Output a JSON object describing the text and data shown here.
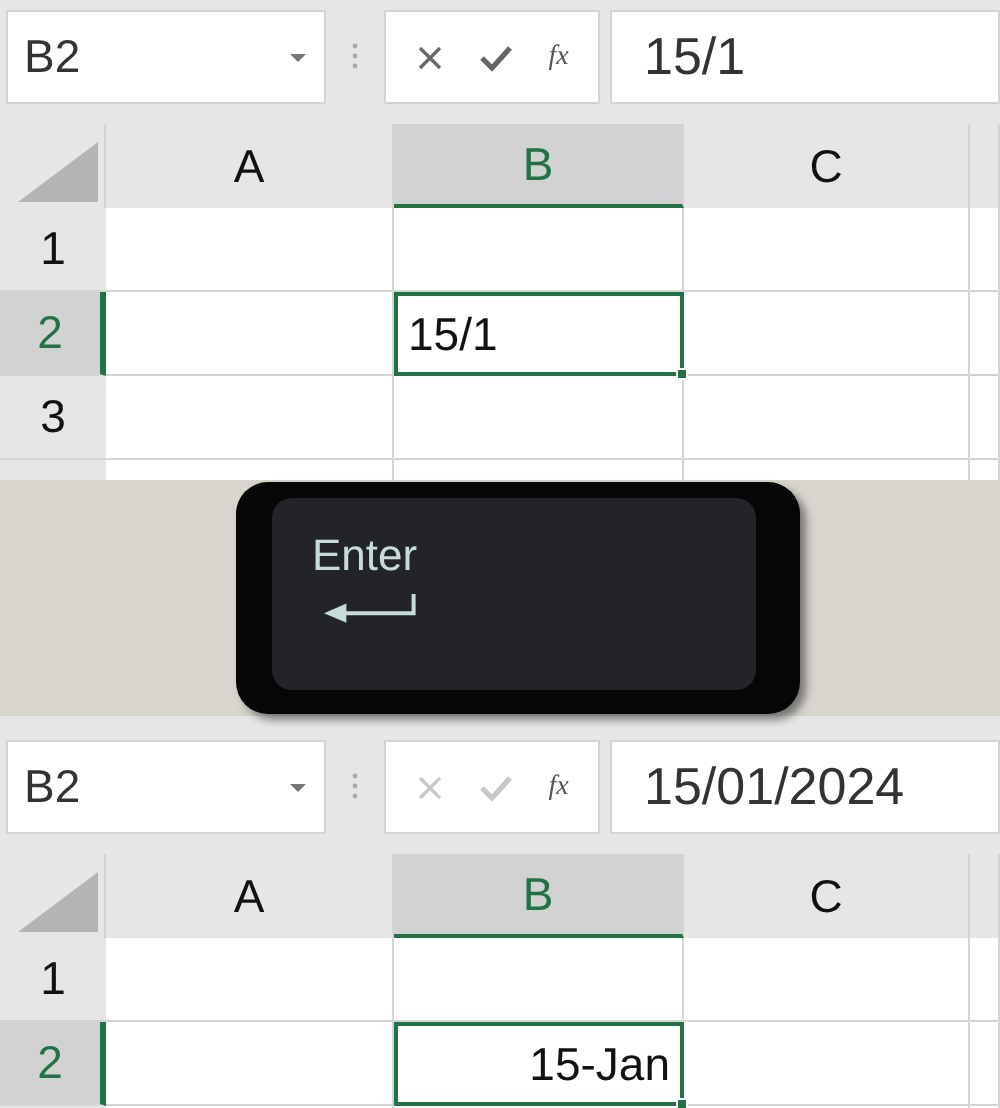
{
  "panels": [
    {
      "name_box": "B2",
      "function_button": "fx",
      "formula": "15/1",
      "editing": true,
      "columns": [
        {
          "label": "A",
          "selected": false
        },
        {
          "label": "B",
          "selected": true
        },
        {
          "label": "C",
          "selected": false
        }
      ],
      "rows": [
        {
          "label": "1",
          "selected": false
        },
        {
          "label": "2",
          "selected": true
        },
        {
          "label": "3",
          "selected": false
        }
      ],
      "active_cell": {
        "text": "15/1",
        "kind": "text"
      }
    },
    {
      "name_box": "B2",
      "function_button": "fx",
      "formula": "15/01/2024",
      "editing": false,
      "columns": [
        {
          "label": "A",
          "selected": false
        },
        {
          "label": "B",
          "selected": true
        },
        {
          "label": "C",
          "selected": false
        }
      ],
      "rows": [
        {
          "label": "1",
          "selected": false
        },
        {
          "label": "2",
          "selected": true
        }
      ],
      "active_cell": {
        "text": "15-Jan",
        "kind": "date"
      }
    }
  ],
  "key": {
    "label": "Enter"
  }
}
